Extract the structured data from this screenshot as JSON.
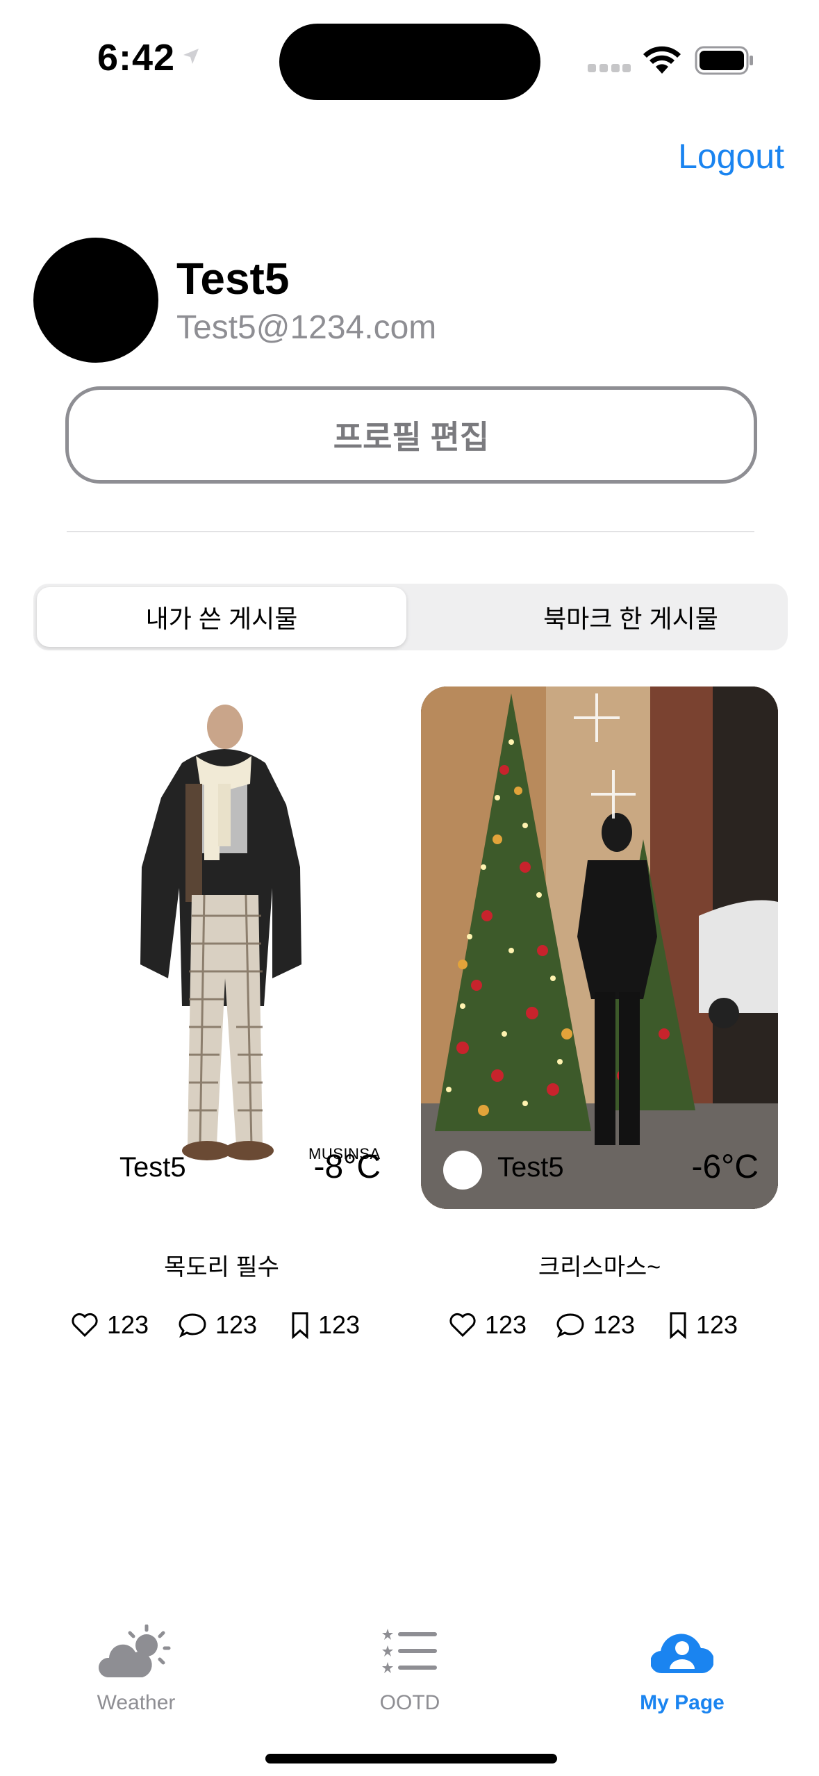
{
  "status_bar": {
    "time": "6:42"
  },
  "header": {
    "logout_label": "Logout"
  },
  "profile": {
    "name": "Test5",
    "email": "Test5@1234.com",
    "edit_button_label": "프로필 편집"
  },
  "segment": {
    "options": [
      "내가 쓴 게시물",
      "북마크 한 게시물"
    ],
    "selected": "내가 쓴 게시물"
  },
  "posts": [
    {
      "author": "Test5",
      "temperature": "-8°C",
      "brand_watermark": "MUSINSA",
      "title": "목도리 필수",
      "likes": "123",
      "comments": "123",
      "bookmarks": "123"
    },
    {
      "author": "Test5",
      "temperature": "-6°C",
      "title": "크리스마스~",
      "likes": "123",
      "comments": "123",
      "bookmarks": "123"
    }
  ],
  "tab_bar": {
    "items": [
      {
        "label": "Weather",
        "icon": "cloud-sun-icon"
      },
      {
        "label": "OOTD",
        "icon": "list-star-icon"
      },
      {
        "label": "My Page",
        "icon": "person-cloud-icon"
      }
    ],
    "active": "My Page",
    "active_color": "#1a84f0",
    "inactive_color": "#8e8e93"
  }
}
